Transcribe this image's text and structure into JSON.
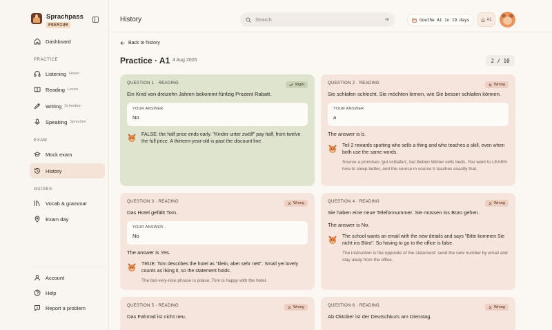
{
  "brand": {
    "name": "Sprachpass",
    "tier": "PREMIUM"
  },
  "sidebar": {
    "dashboard": "Dashboard",
    "sections": {
      "practice": "PRACTICE",
      "exam": "EXAM",
      "guides": "GUIDES"
    },
    "practice_items": [
      {
        "label": "Listening",
        "sub": "Hören"
      },
      {
        "label": "Reading",
        "sub": "Lesen"
      },
      {
        "label": "Writing",
        "sub": "Schreiben"
      },
      {
        "label": "Speaking",
        "sub": "Sprechen"
      }
    ],
    "exam_items": [
      {
        "label": "Mock exam"
      },
      {
        "label": "History"
      }
    ],
    "guide_items": [
      {
        "label": "Vocab & grammar"
      },
      {
        "label": "Exam day"
      }
    ],
    "footer_items": [
      {
        "label": "Account"
      },
      {
        "label": "Help"
      },
      {
        "label": "Report a problem"
      }
    ]
  },
  "header": {
    "title": "History",
    "search_placeholder": "Search",
    "search_shortcut": "⌘K",
    "countdown": "Goethe A1 in 19 days",
    "level": "A1"
  },
  "main": {
    "back": "Back to history",
    "title": "Practice · A1",
    "date": "4 Aug 2026",
    "pager": "2 / 10"
  },
  "labels": {
    "your_answer": "YOUR ANSWER"
  },
  "questions": [
    {
      "label": "QUESTION 1 · READING",
      "verdict": "Right",
      "text": "Ein Kind von dreizehn Jahren bekommt fünfzig Prozent Rabatt.",
      "answer": "No",
      "correct": "",
      "explanation": "FALSE: the half price ends early. \"Kinder unter zwölf\" pay half, from twelve the full price. A thirteen-year-old is past the discount line.",
      "note": ""
    },
    {
      "label": "QUESTION 2 · READING",
      "verdict": "Wrong",
      "text": "Sie schlafen schlecht. Sie möchten lernen, wie Sie besser schlafen können.",
      "answer": "a",
      "correct": "The answer is b.",
      "explanation": "Teil 2 rewards spotting who sells a thing and who teaches a skill, even when both use the same words.",
      "note": "Source a promises 'gut schlafen', but Betten Winter sells beds. You want to LEARN how to sleep better, and the course in source b teaches exactly that."
    },
    {
      "label": "QUESTION 3 · READING",
      "verdict": "Wrong",
      "text": "Das Hotel gefällt Tom.",
      "answer": "No",
      "correct": "The answer is Yes.",
      "explanation": "TRUE: Tom describes the hotel as \"klein, aber sehr nett\". Small yet lovely counts as liking it, so the statement holds.",
      "note": "The but-very-nice phrase is praise; Tom is happy with the hotel."
    },
    {
      "label": "QUESTION 4 · READING",
      "verdict": "Wrong",
      "text": "Sie haben eine neue Telefonnummer. Sie müssen ins Büro gehen.",
      "answer": "",
      "correct": "The answer is No.",
      "explanation": "The school wants an email with the new details and says \"Bitte kommen Sie nicht ins Büro\". So having to go to the office is false.",
      "note": "The instruction is the opposite of the statement: send the new number by email and stay away from the office."
    },
    {
      "label": "QUESTION 5 · READING",
      "verdict": "Wrong",
      "text": "Das Fahrrad ist nicht neu.",
      "answer": "",
      "correct": "",
      "explanation": "",
      "note": ""
    },
    {
      "label": "QUESTION 6 · READING",
      "verdict": "Wrong",
      "text": "Ab Oktober ist der Deutschkurs am Dienstag.",
      "answer": "",
      "correct": "",
      "explanation": "",
      "note": ""
    }
  ]
}
